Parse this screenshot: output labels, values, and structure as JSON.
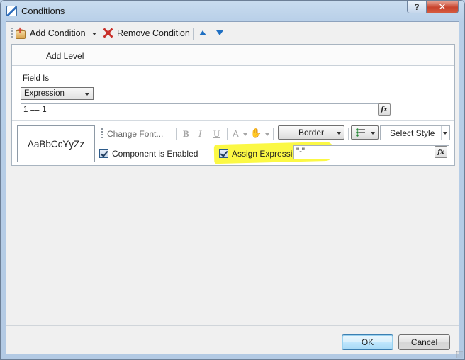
{
  "window": {
    "title": "Conditions",
    "help_glyph": "?",
    "close_glyph": "✕"
  },
  "toolbar": {
    "add_condition": "Add Condition",
    "remove_condition": "Remove Condition"
  },
  "panel": {
    "add_level": "Add Level",
    "field_is_label": "Field Is",
    "field_is_value": "Expression",
    "expression": "1 == 1",
    "fx_label": "fx"
  },
  "style": {
    "preview_text": "AaBbCcYyZz",
    "change_font": "Change Font...",
    "bold": "B",
    "italic": "I",
    "underline": "U",
    "font_color": "A",
    "border_label": "Border",
    "select_style": "Select Style"
  },
  "options": {
    "component_enabled_label": "Component is Enabled",
    "component_enabled_checked": true,
    "assign_expression_label": "Assign Expression",
    "assign_expression_checked": true,
    "assign_expression_value": "\"-\""
  },
  "buttons": {
    "ok": "OK",
    "cancel": "Cancel"
  },
  "colors": {
    "highlight": "#fbf83a",
    "accent": "#1f6fc2"
  }
}
